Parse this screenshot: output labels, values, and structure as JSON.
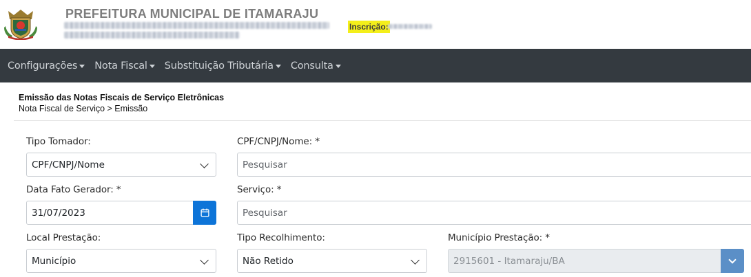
{
  "header": {
    "org_title": "PREFEITURA MUNICIPAL DE ITAMARAJU",
    "inscricao_label": "Inscrição:"
  },
  "icons": {
    "crest": "municipal-crest-icon",
    "calendar": "calendar-icon",
    "chevron": "chevron-down-icon"
  },
  "colors": {
    "navbar": "#343a40",
    "primary_button": "#0d74d8",
    "highlight": "#f4ef1a"
  },
  "nav": {
    "items": [
      {
        "label": "Configurações"
      },
      {
        "label": "Nota Fiscal"
      },
      {
        "label": "Substituição Tributária"
      },
      {
        "label": "Consulta"
      }
    ]
  },
  "page": {
    "title": "Emissão das Notas Fiscais de Serviço Eletrônicas",
    "breadcrumb": "Nota Fiscal de Serviço > Emissão"
  },
  "form": {
    "tipo_tomador": {
      "label": "Tipo Tomador:",
      "value": "CPF/CNPJ/Nome"
    },
    "cpf_cnpj_nome": {
      "label": "CPF/CNPJ/Nome: *",
      "placeholder": "Pesquisar"
    },
    "data_fato_gerador": {
      "label": "Data Fato Gerador: *",
      "value": "31/07/2023"
    },
    "servico": {
      "label": "Serviço: *",
      "placeholder": "Pesquisar"
    },
    "local_prestacao": {
      "label": "Local Prestação:",
      "value": "Município"
    },
    "tipo_recolhimento": {
      "label": "Tipo Recolhimento:",
      "value": "Não Retido"
    },
    "municipio_prestacao": {
      "label": "Município Prestação: *",
      "value": "2915601 - Itamaraju/BA"
    }
  }
}
